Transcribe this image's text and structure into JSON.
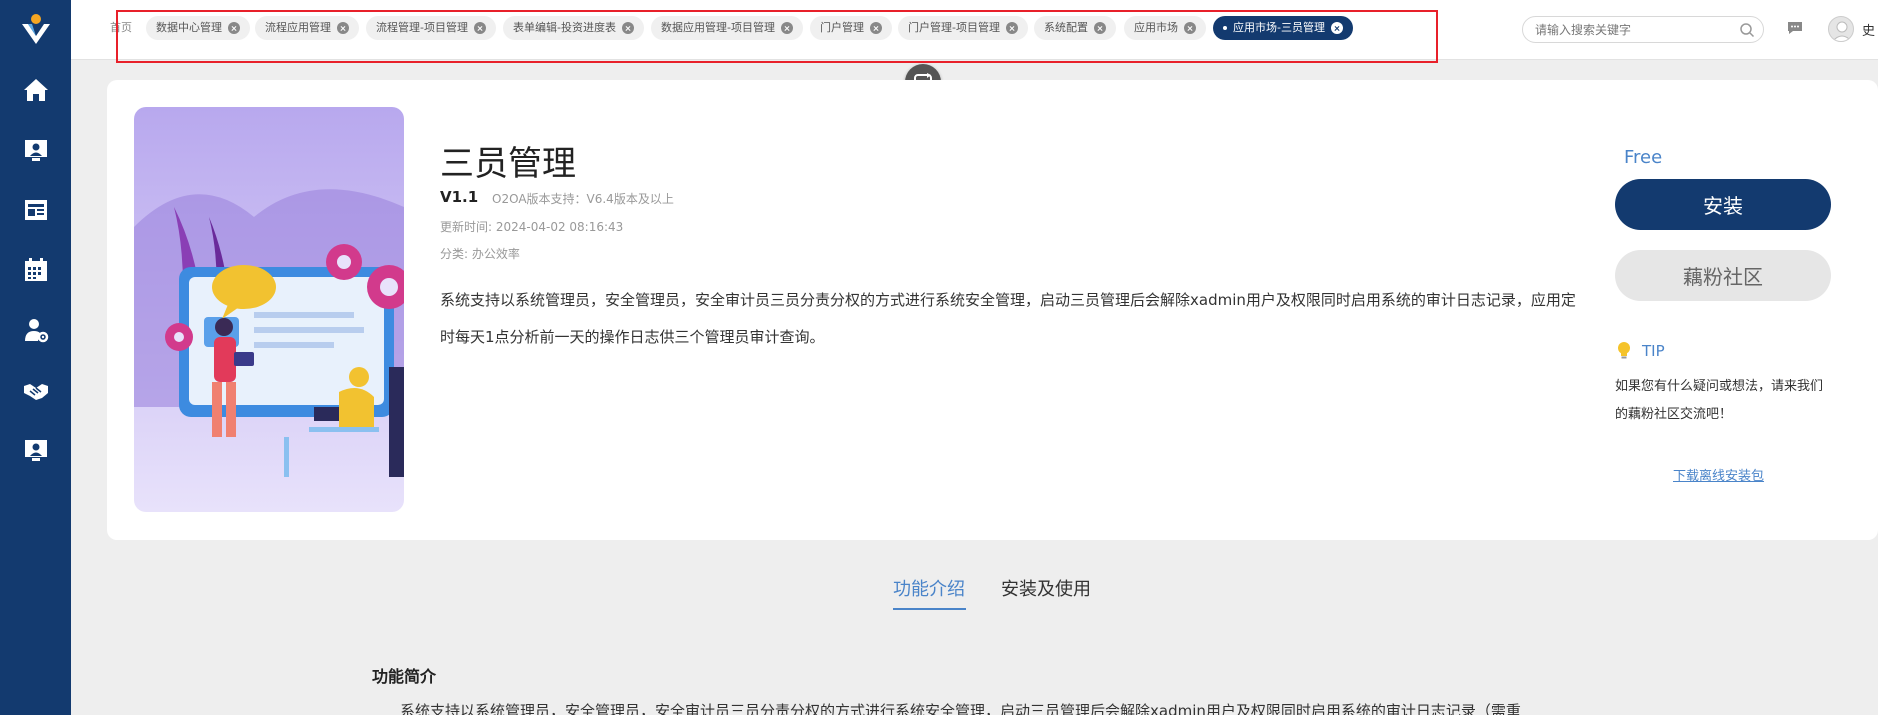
{
  "sidebar": {
    "items": [
      {
        "name": "home-icon"
      },
      {
        "name": "user-screen-icon"
      },
      {
        "name": "news-icon"
      },
      {
        "name": "calendar-icon"
      },
      {
        "name": "user-settings-icon"
      },
      {
        "name": "handshake-icon"
      },
      {
        "name": "presenter-icon"
      }
    ]
  },
  "tabs": [
    {
      "label": "首页"
    },
    {
      "label": "数据中心管理"
    },
    {
      "label": "流程应用管理"
    },
    {
      "label": "流程管理-项目管理"
    },
    {
      "label": "表单编辑-投资进度表"
    },
    {
      "label": "数据应用管理-项目管理"
    },
    {
      "label": "门户管理"
    },
    {
      "label": "门户管理-项目管理"
    },
    {
      "label": "系统配置"
    },
    {
      "label": "应用市场"
    },
    {
      "label": "应用市场-三员管理"
    }
  ],
  "search": {
    "placeholder": "请输入搜索关键字"
  },
  "user": {
    "name": "史"
  },
  "app": {
    "title": "三员管理",
    "version": "V1.1",
    "support": "O2OA版本支持：V6.4版本及以上",
    "updated": "更新时间: 2024-04-02 08:16:43",
    "category": "分类: 办公效率",
    "description": "系统支持以系统管理员，安全管理员，安全审计员三员分责分权的方式进行系统安全管理，启动三员管理后会解除xadmin用户及权限同时启用系统的审计日志记录，应用定时每天1点分析前一天的操作日志供三个管理员审计查询。"
  },
  "side_panel": {
    "price": "Free",
    "install": "安装",
    "community": "藕粉社区",
    "tip_label": "TIP",
    "tip_text": "如果您有什么疑问或想法，请来我们的藕粉社区交流吧！",
    "download": "下载离线安装包"
  },
  "detail_tabs": {
    "intro": "功能介绍",
    "install_use": "安装及使用"
  },
  "intro": {
    "title": "功能简介",
    "text": "系统支持以系统管理员，安全管理员，安全审计员三员分责分权的方式进行系统安全管理，启动三员管理后会解除xadmin用户及权限同时启用系统的审计日志记录（需重"
  },
  "colors": {
    "sidebar": "#133a6f",
    "accent": "#4a84c9",
    "highlight": "#e8202a"
  }
}
